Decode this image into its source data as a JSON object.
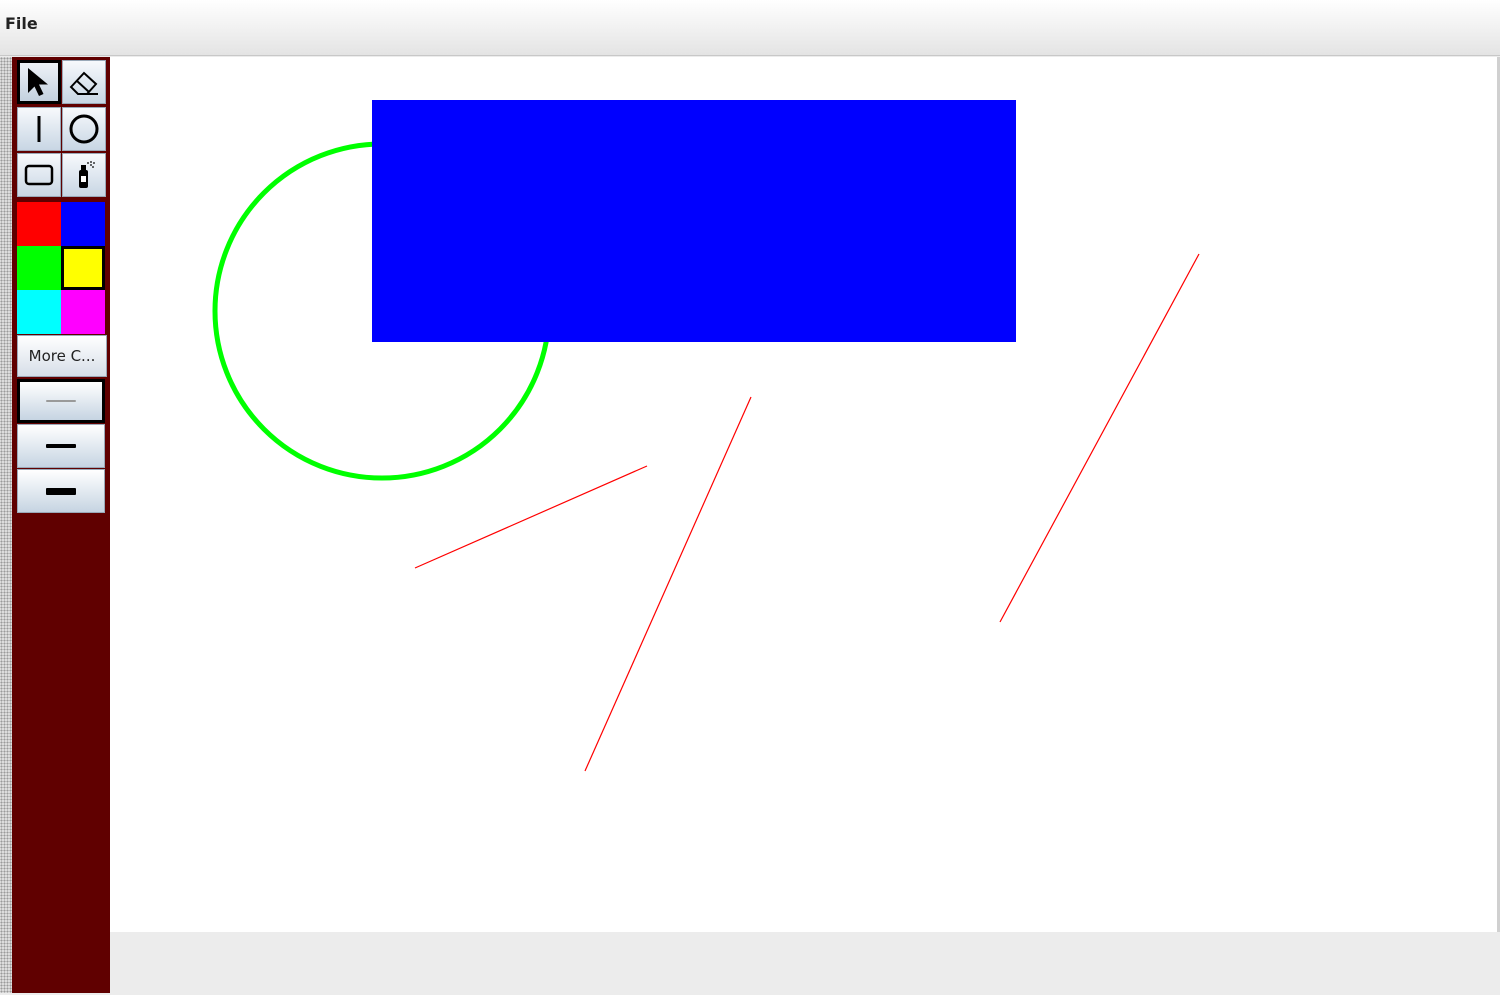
{
  "menu": {
    "items": [
      {
        "label": "File"
      }
    ]
  },
  "toolbar": {
    "tools": [
      {
        "name": "select",
        "icon": "arrow-pointer-icon",
        "selected": true
      },
      {
        "name": "eraser",
        "icon": "eraser-icon",
        "selected": false
      },
      {
        "name": "line",
        "icon": "line-icon",
        "selected": false
      },
      {
        "name": "circle",
        "icon": "circle-icon",
        "selected": false
      },
      {
        "name": "rectangle",
        "icon": "rectangle-icon",
        "selected": false
      },
      {
        "name": "spray",
        "icon": "spray-can-icon",
        "selected": false
      }
    ],
    "colors": [
      {
        "name": "red",
        "hex": "#ff0000",
        "selected": false
      },
      {
        "name": "blue",
        "hex": "#0000ff",
        "selected": false
      },
      {
        "name": "green",
        "hex": "#00ff00",
        "selected": false
      },
      {
        "name": "yellow",
        "hex": "#ffff00",
        "selected": true
      },
      {
        "name": "cyan",
        "hex": "#00ffff",
        "selected": false
      },
      {
        "name": "magenta",
        "hex": "#ff00ff",
        "selected": false
      }
    ],
    "more_colors_label": "More C...",
    "stroke_widths": [
      {
        "name": "thin",
        "selected": true
      },
      {
        "name": "medium",
        "selected": false
      },
      {
        "name": "thick",
        "selected": false
      }
    ],
    "background_color": "#600000"
  },
  "canvas": {
    "background": "#ffffff",
    "shapes": [
      {
        "type": "circle",
        "color": "#00ff00"
      },
      {
        "type": "rectangle",
        "color": "#0000ff",
        "filled": true
      },
      {
        "type": "line",
        "color": "#ff0000"
      },
      {
        "type": "line",
        "color": "#ff0000"
      },
      {
        "type": "line",
        "color": "#ff0000"
      }
    ]
  }
}
